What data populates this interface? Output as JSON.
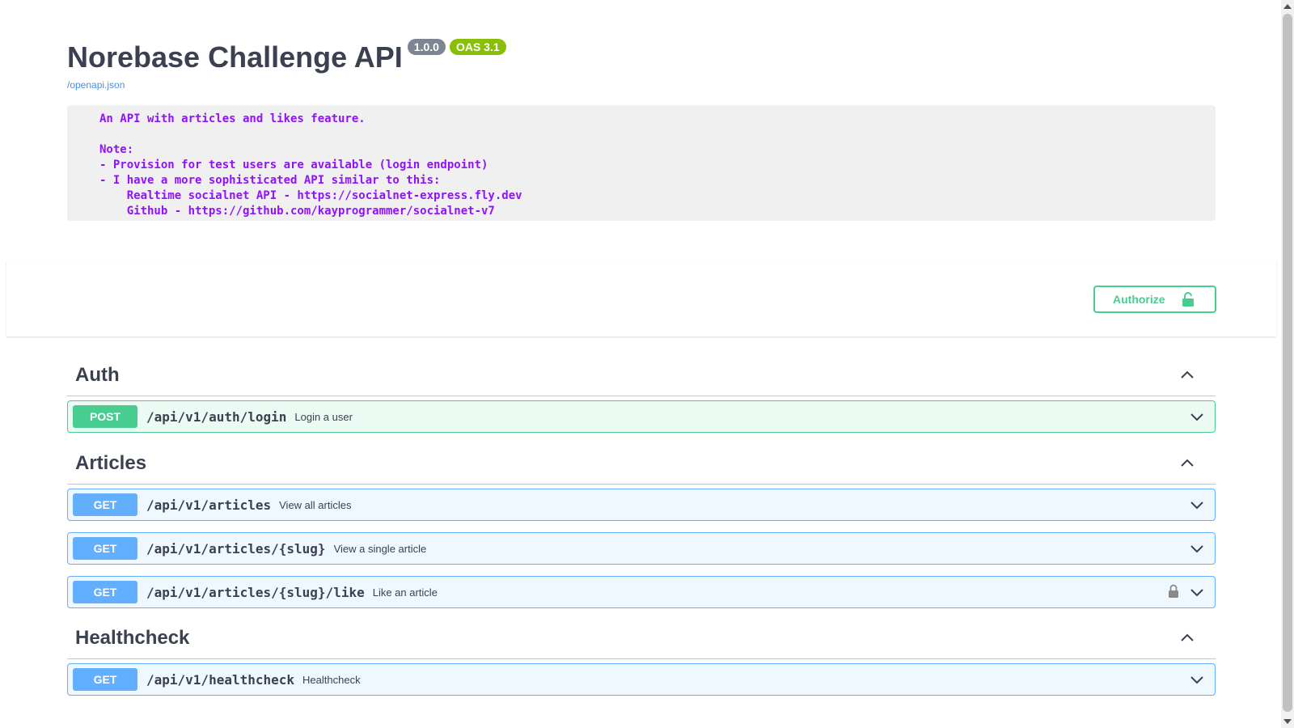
{
  "info": {
    "title": "Norebase Challenge API",
    "version": "1.0.0",
    "oas_version": "OAS 3.1",
    "spec_link": "/openapi.json",
    "description": "An API with articles and likes feature.\n\nNote:\n- Provision for test users are available (login endpoint)\n- I have a more sophisticated API similar to this:\n    Realtime socialnet API - https://socialnet-express.fly.dev\n    Github - https://github.com/kayprogrammer/socialnet-v7"
  },
  "authorize": {
    "label": "Authorize",
    "icon": "lock-open-icon"
  },
  "tags": [
    {
      "name": "Auth",
      "operations": [
        {
          "method": "POST",
          "path": "/api/v1/auth/login",
          "summary": "Login a user",
          "locked": false
        }
      ]
    },
    {
      "name": "Articles",
      "operations": [
        {
          "method": "GET",
          "path": "/api/v1/articles",
          "summary": "View all articles",
          "locked": false
        },
        {
          "method": "GET",
          "path": "/api/v1/articles/{slug}",
          "summary": "View a single article",
          "locked": false
        },
        {
          "method": "GET",
          "path": "/api/v1/articles/{slug}/like",
          "summary": "Like an article",
          "locked": true
        }
      ]
    },
    {
      "name": "Healthcheck",
      "operations": [
        {
          "method": "GET",
          "path": "/api/v1/healthcheck",
          "summary": "Healthcheck",
          "locked": false
        }
      ]
    }
  ],
  "colors": {
    "post": "#49cc90",
    "get": "#61affe",
    "description_text": "#9012fe",
    "badge_version": "#7d8492",
    "badge_oas": "#89bf04",
    "link": "#4990e2"
  }
}
